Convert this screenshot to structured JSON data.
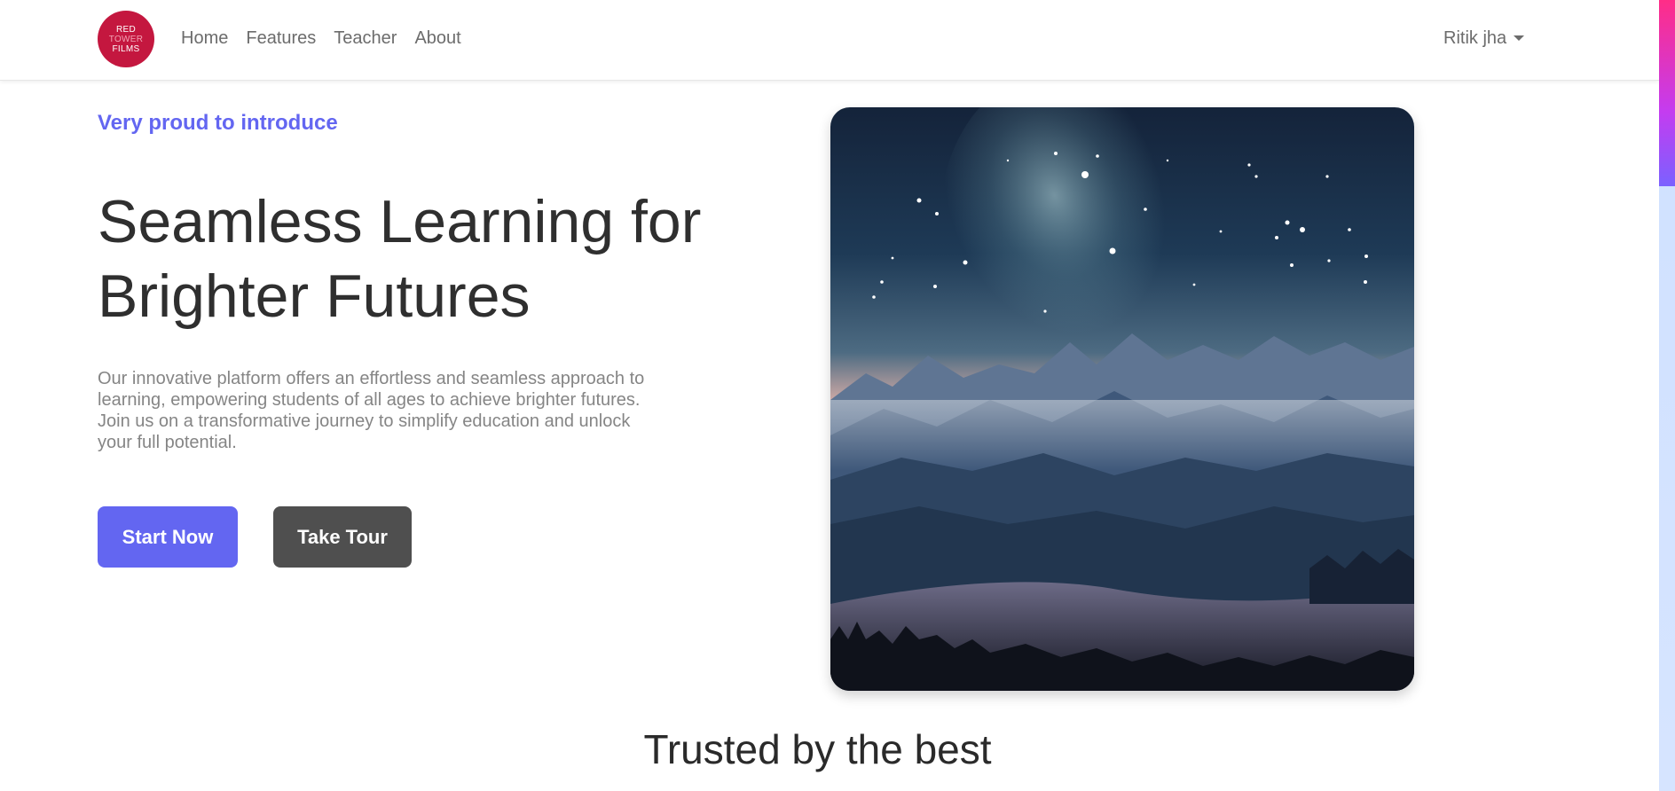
{
  "brand": {
    "logo_lines": [
      "RED",
      "TOWER",
      "FILMS"
    ],
    "logo_color": "#c4173f"
  },
  "nav": {
    "items": [
      {
        "label": "Home"
      },
      {
        "label": "Features"
      },
      {
        "label": "Teacher"
      },
      {
        "label": "About"
      }
    ],
    "user_name": "Ritik jha"
  },
  "hero": {
    "intro": "Very proud to introduce",
    "headline": "Seamless Learning for Brighter Futures",
    "description": "Our innovative platform offers an effortless and seamless approach to learning, empowering students of all ages to achieve brighter futures. Join us on a transformative journey to simplify education and unlock your full potential.",
    "primary_button": "Start Now",
    "secondary_button": "Take Tour",
    "accent_color": "#6366f1"
  },
  "trusted": {
    "heading": "Trusted by the best"
  }
}
